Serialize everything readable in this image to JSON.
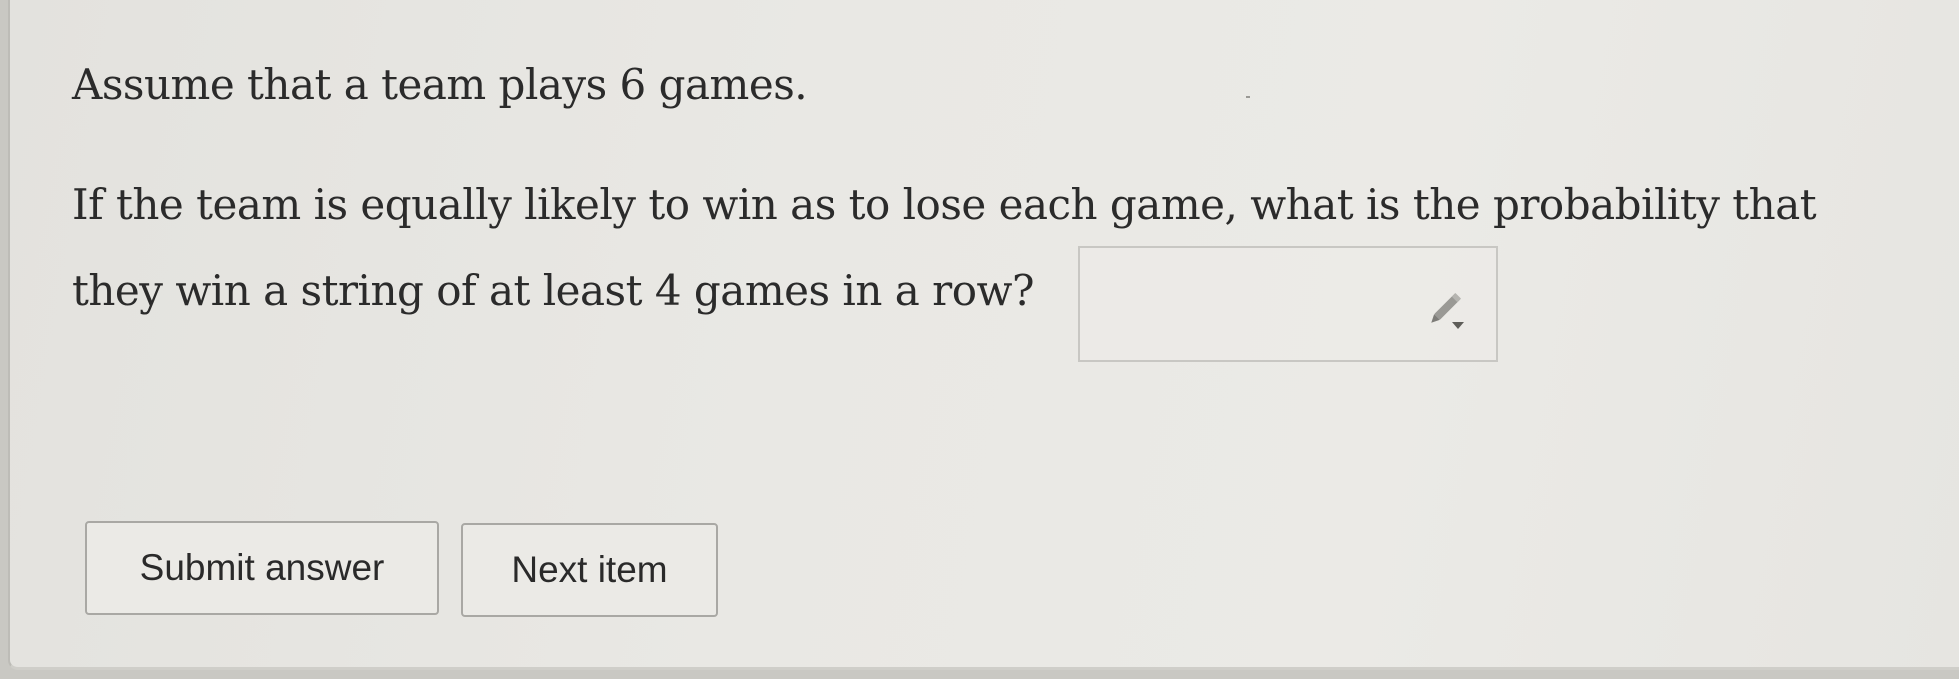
{
  "question": {
    "line1": "Assume that a team plays 6 games.",
    "line2": "If the team is equally likely to win as to lose each game, what is the probability that",
    "line3": "they win a string of at least 4 games in a row?"
  },
  "answer": {
    "value": "",
    "icon": "pencil-icon"
  },
  "buttons": {
    "submit_label": "Submit answer",
    "next_label": "Next item"
  }
}
